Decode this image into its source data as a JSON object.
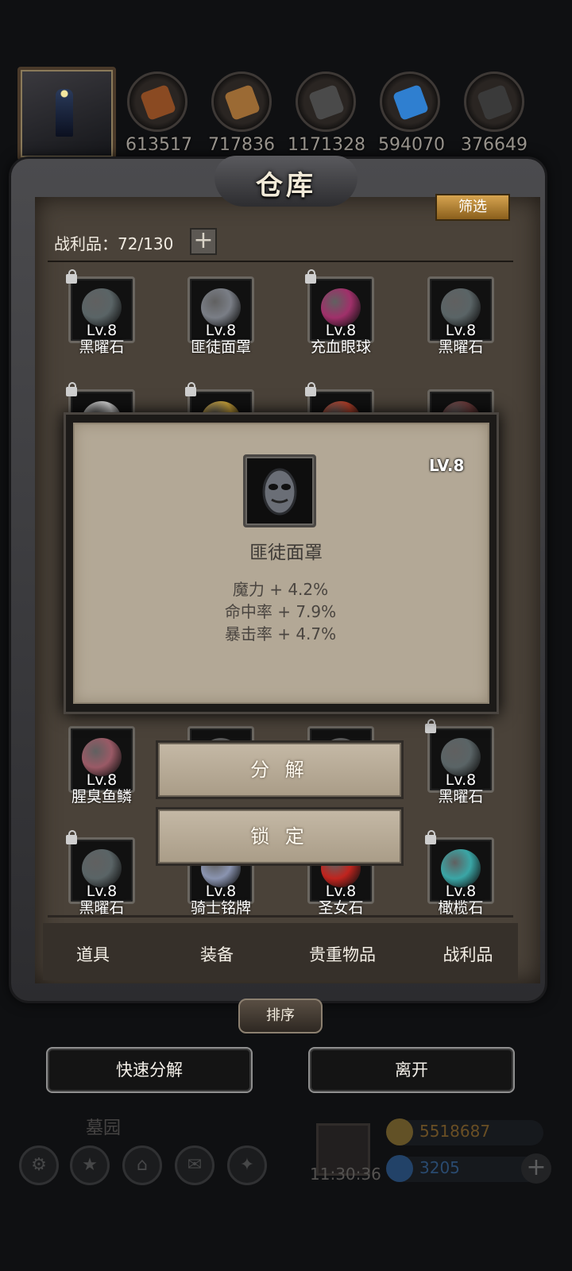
{
  "resources": [
    {
      "name": "leather",
      "count": "613517",
      "color": "#8a4a22"
    },
    {
      "name": "wood",
      "count": "717836",
      "color": "#9b6a34"
    },
    {
      "name": "iron",
      "count": "1171328",
      "color": "#4a4a4a"
    },
    {
      "name": "crystal",
      "count": "594070",
      "color": "#2f7fd0"
    },
    {
      "name": "ore",
      "count": "376649",
      "color": "#3a3a3a"
    }
  ],
  "panel": {
    "title": "仓库",
    "filter_label": "筛选",
    "capacity_label": "战利品：72/130",
    "plus": "+"
  },
  "items": [
    {
      "name": "黑曜石",
      "level": "Lv.8",
      "locked": true,
      "icon": "obsidian-icon",
      "color": "#5a6466"
    },
    {
      "name": "匪徒面罩",
      "level": "Lv.8",
      "locked": false,
      "icon": "mask-icon",
      "color": "#7a7e86"
    },
    {
      "name": "充血眼球",
      "level": "Lv.8",
      "locked": true,
      "icon": "eyeball-icon",
      "color": "#a0306a"
    },
    {
      "name": "黑曜石",
      "level": "Lv.8",
      "locked": false,
      "icon": "obsidian-icon",
      "color": "#5a6466"
    },
    {
      "name": "",
      "level": "",
      "locked": true,
      "icon": "fang-icon",
      "color": "#cfcfcf"
    },
    {
      "name": "",
      "level": "",
      "locked": true,
      "icon": "crown-icon",
      "color": "#c9a23a"
    },
    {
      "name": "",
      "level": "",
      "locked": true,
      "icon": "claw-icon",
      "color": "#b3402a"
    },
    {
      "name": "",
      "level": "",
      "locked": false,
      "icon": "feather-icon",
      "color": "#6a3a3a"
    },
    {
      "name": "腥臭鱼鳞",
      "level": "Lv.8",
      "locked": false,
      "icon": "scale-icon",
      "color": "#9a5a66"
    },
    {
      "name": "",
      "level": "",
      "locked": false,
      "icon": "item-icon",
      "color": "#555"
    },
    {
      "name": "",
      "level": "",
      "locked": false,
      "icon": "item-icon",
      "color": "#555"
    },
    {
      "name": "黑曜石",
      "level": "Lv.8",
      "locked": true,
      "icon": "obsidian-icon",
      "color": "#5a6466"
    },
    {
      "name": "黑曜石",
      "level": "Lv.8",
      "locked": true,
      "icon": "obsidian-icon",
      "color": "#5a6466"
    },
    {
      "name": "骑士铭牌",
      "level": "Lv.8",
      "locked": false,
      "icon": "badge-icon",
      "color": "#8a94b0"
    },
    {
      "name": "圣女石",
      "level": "Lv.8",
      "locked": false,
      "icon": "gem-icon",
      "color": "#c0241e"
    },
    {
      "name": "橄榄石",
      "level": "Lv.8",
      "locked": true,
      "icon": "olivine-icon",
      "color": "#3aa6a6"
    }
  ],
  "tabs": [
    "道具",
    "装备",
    "贵重物品",
    "战利品"
  ],
  "sort_label": "排序",
  "quick_decompose_label": "快速分解",
  "leave_label": "离开",
  "hud": {
    "location": "墓园",
    "gold": "5518687",
    "gems": "3205",
    "time": "11:30:36"
  },
  "popup": {
    "level": "LV.8",
    "name": "匪徒面罩",
    "stats": [
      "魔力 + 4.2%",
      "命中率 + 7.9%",
      "暴击率 + 4.7%"
    ]
  },
  "menu": {
    "decompose_label": "分 解",
    "lock_label": "锁 定"
  },
  "colors": {
    "filter": "#d6a450",
    "popup_bg": "#b3a896",
    "menu_bg": "#b8ab97"
  }
}
